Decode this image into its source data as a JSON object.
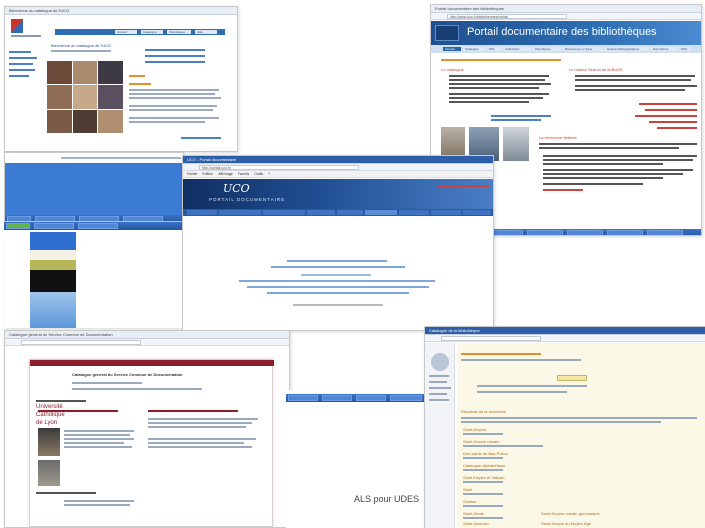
{
  "s1": {
    "tab": "Bienvenue au catalogue de l'UCO",
    "nav": [
      "Accueil",
      "Catalogue",
      "Périodiques",
      "Aide"
    ],
    "heading": "Bienvenue au catalogue de l'UCO"
  },
  "s2": {
    "tab": "Portail documentaire des bibliothèques",
    "url": "http://www.uco.fr/bibliotheques/portail",
    "title": "Portail documentaire des bibliothèques",
    "nav": [
      "Accueil",
      "Catalogue",
      "Plan",
      "Collections",
      "Périodiques",
      "Ressources en ligne",
      "Guides bibliographiques",
      "Expositions",
      "FAQ"
    ],
    "left_heading": "Le catalogue",
    "right_heading": "Le moteur Search de la BUSS",
    "right_heading2": "La recherche fédérée"
  },
  "s3": {
    "tab": "UCO - Portail documentaire",
    "url": "http://portail.uco.fr/",
    "menu": [
      "Fichier",
      "Edition",
      "Affichage",
      "Favoris",
      "Outils",
      "?"
    ],
    "logo": "UCO",
    "banner": "PORTAIL DOCUMENTAIRE"
  },
  "s4": {
    "tab": "Catalogue général du Service Commun de Documentation",
    "logo_line1": "Université",
    "logo_line2": "Catholique",
    "logo_line3": "de Lyon",
    "heading": "Catalogue général du Service Commun de Documentation"
  },
  "s6": {
    "tab": "Catalogue de la bibliothèque",
    "results_heading": "Résultats de la recherche",
    "results": [
      "Saint-Empire",
      "Saint-Empire romain",
      "Des saints du Bas-Poitou",
      "Catalogue alphabétique",
      "Saint Empire et Vatican",
      "Saint",
      "Saintes",
      "Saint-Denis",
      "Saint-Germain",
      "Saint-Empire romain germanique",
      "Saint-Empire au Moyen Âge"
    ]
  },
  "caption": "ALS pour UDES"
}
